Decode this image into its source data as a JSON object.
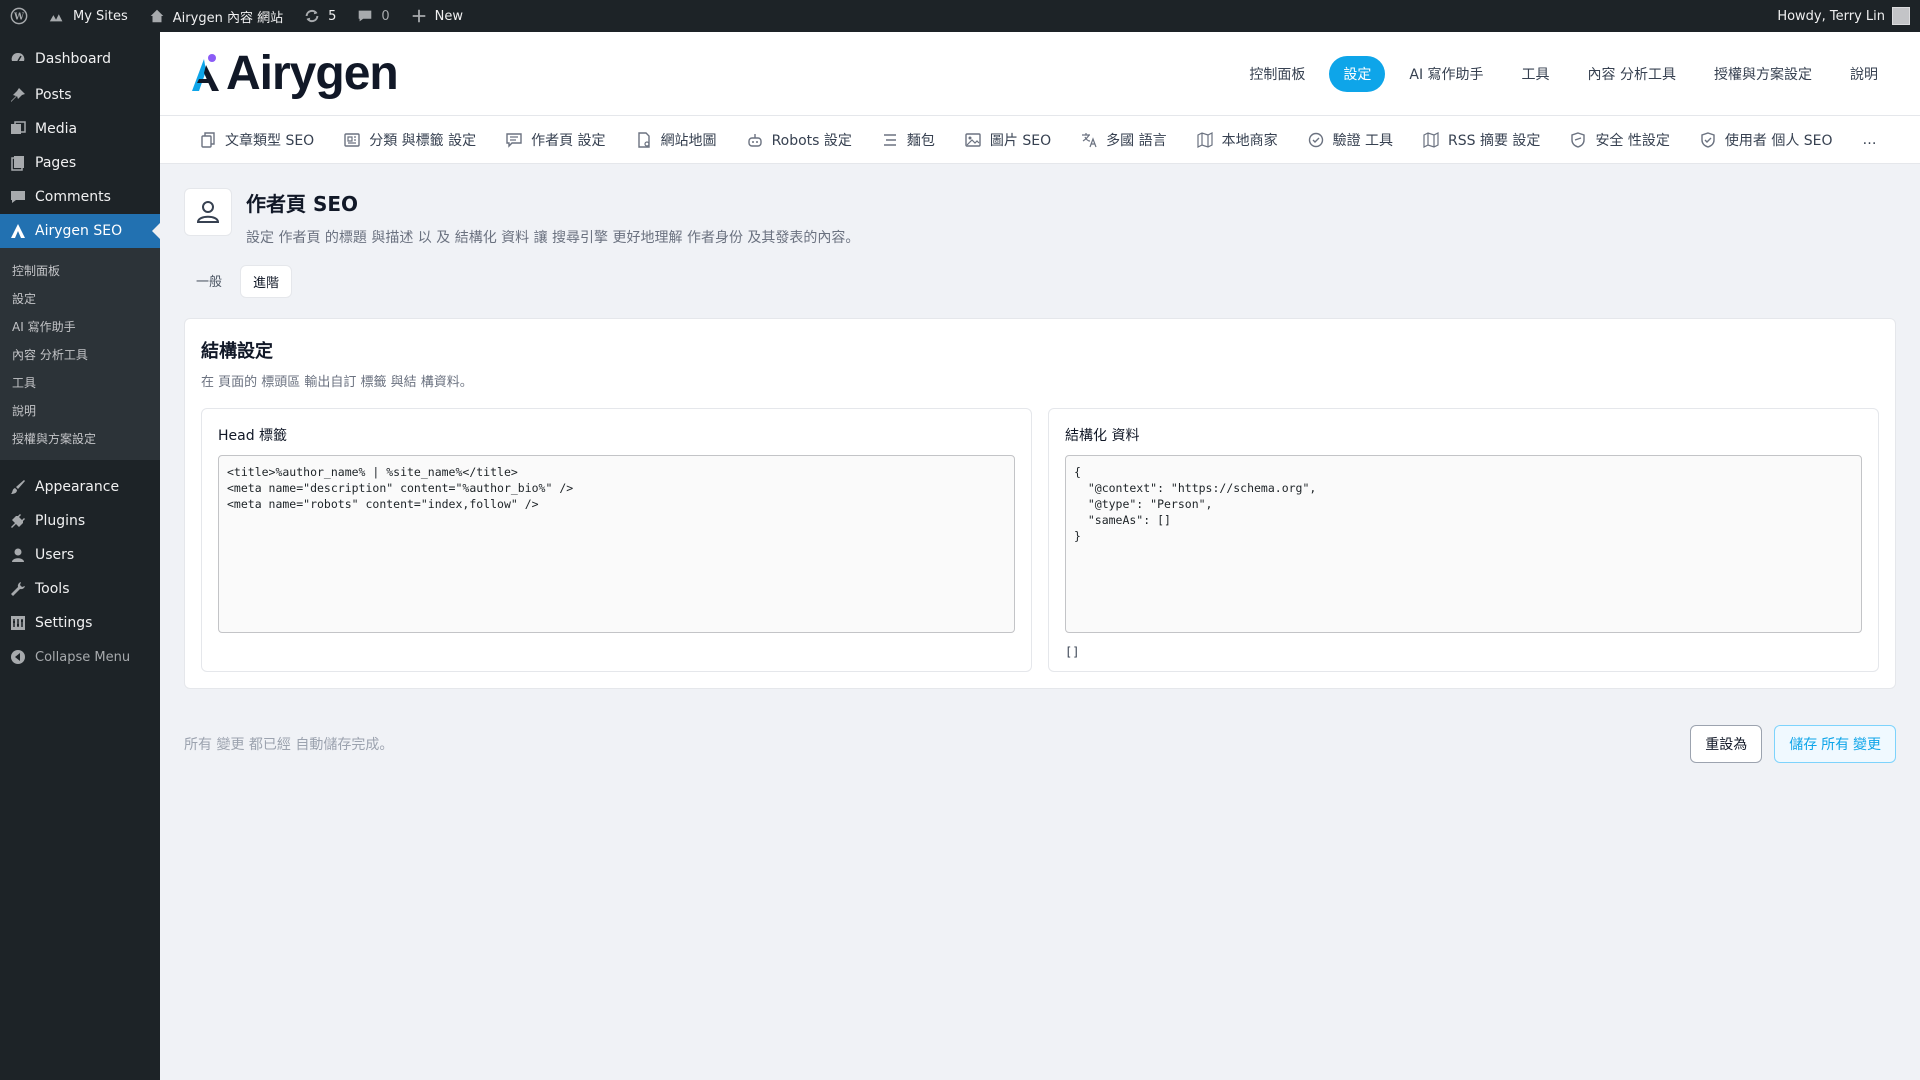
{
  "admin_bar": {
    "my_sites": "My Sites",
    "site_name": "Airygen 內容 網站",
    "updates_count": "5",
    "comments_count": "0",
    "new_label": "New",
    "howdy": "Howdy, Terry Lin"
  },
  "sidebar": {
    "items": [
      {
        "label": "Dashboard",
        "icon": "dashboard-icon"
      },
      {
        "label": "Posts",
        "icon": "pin-icon"
      },
      {
        "label": "Media",
        "icon": "media-icon"
      },
      {
        "label": "Pages",
        "icon": "pages-icon"
      },
      {
        "label": "Comments",
        "icon": "comment-icon"
      },
      {
        "label": "Airygen SEO",
        "icon": "airygen-icon",
        "active": true
      }
    ],
    "submenu": [
      "控制面板",
      "設定",
      "AI 寫作助手",
      "內容 分析工具",
      "工具",
      "說明",
      "授權與方案設定"
    ],
    "items2": [
      {
        "label": "Appearance",
        "icon": "brush-icon"
      },
      {
        "label": "Plugins",
        "icon": "plug-icon"
      },
      {
        "label": "Users",
        "icon": "user-icon"
      },
      {
        "label": "Tools",
        "icon": "wrench-icon"
      },
      {
        "label": "Settings",
        "icon": "settings-icon"
      }
    ],
    "collapse": "Collapse Menu"
  },
  "header": {
    "logo": "Airygen",
    "nav": [
      "控制面板",
      "設定",
      "AI 寫作助手",
      "工具",
      "內容 分析工具",
      "授權與方案設定",
      "說明"
    ],
    "active_nav": 1
  },
  "tabs": [
    {
      "label": "文章類型 SEO",
      "icon": "copy-icon"
    },
    {
      "label": "分類 與標籤 設定",
      "icon": "newspaper-icon"
    },
    {
      "label": "作者頁 設定",
      "icon": "message-icon"
    },
    {
      "label": "網站地圖",
      "icon": "file-icon"
    },
    {
      "label": "Robots 設定",
      "icon": "robot-icon"
    },
    {
      "label": "麵包",
      "icon": "list-icon"
    },
    {
      "label": "圖片 SEO",
      "icon": "image-icon"
    },
    {
      "label": "多國 語言",
      "icon": "translate-icon"
    },
    {
      "label": "本地商家",
      "icon": "map-icon"
    },
    {
      "label": "驗證 工具",
      "icon": "check-circle-icon"
    },
    {
      "label": "RSS 摘要 設定",
      "icon": "rss-icon"
    },
    {
      "label": "安全 性設定",
      "icon": "shield-icon"
    },
    {
      "label": "使用者 個人 SEO",
      "icon": "shield-check-icon"
    },
    {
      "label": "…",
      "icon": ""
    }
  ],
  "page": {
    "title": "作者頁 SEO",
    "description": "設定 作者頁 的標題 與描述 以 及 結構化 資料 讓 搜尋引擎 更好地理解 作者身份 及其發表的內容。",
    "subtabs": [
      "一般",
      "進階"
    ],
    "active_subtab": 1
  },
  "card": {
    "title": "結構設定",
    "description": "在 頁面的 標頭區 輸出自訂 標籤 與結 構資料。",
    "head_label": "Head 標籤",
    "head_code": "<title>%author_name% | %site_name%</title>\n<meta name=\"description\" content=\"%author_bio%\" />\n<meta name=\"robots\" content=\"index,follow\" />",
    "schema_label": "結構化 資料",
    "schema_code": "{\n  \"@context\": \"https://schema.org\",\n  \"@type\": \"Person\",\n  \"sameAs\": []\n}",
    "schema_footer": "[]"
  },
  "footer": {
    "status": "所有 變更 都已經 自動儲存完成。",
    "reset_button": "重設為",
    "save_button": "儲存 所有 變更"
  }
}
